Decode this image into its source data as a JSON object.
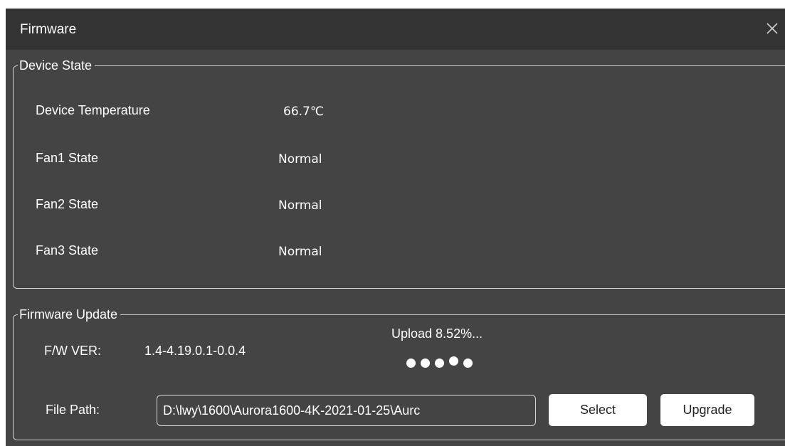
{
  "window": {
    "title": "Firmware",
    "close_icon": "close-icon"
  },
  "device_state": {
    "legend": "Device State",
    "rows": [
      {
        "label": "Device Temperature",
        "value": "66.7℃"
      },
      {
        "label": "Fan1 State",
        "value": "Normal"
      },
      {
        "label": "Fan2 State",
        "value": "Normal"
      },
      {
        "label": "Fan3 State",
        "value": "Normal"
      }
    ]
  },
  "firmware_update": {
    "legend": "Firmware Update",
    "fw_ver_label": "F/W VER:",
    "fw_ver_value": "1.4-4.19.0.1-0.0.4",
    "upload_status": "Upload 8.52%...",
    "upload_progress_percent": 8.52,
    "file_path_label": "File Path:",
    "file_path_value": "D:\\lwy\\1600\\Aurora1600-4K-2021-01-25\\Aurc",
    "select_label": "Select",
    "upgrade_label": "Upgrade"
  },
  "colors": {
    "title_bar": "#333333",
    "panel_background": "#444444",
    "text": "#ffffff",
    "button_background": "#ffffff"
  }
}
